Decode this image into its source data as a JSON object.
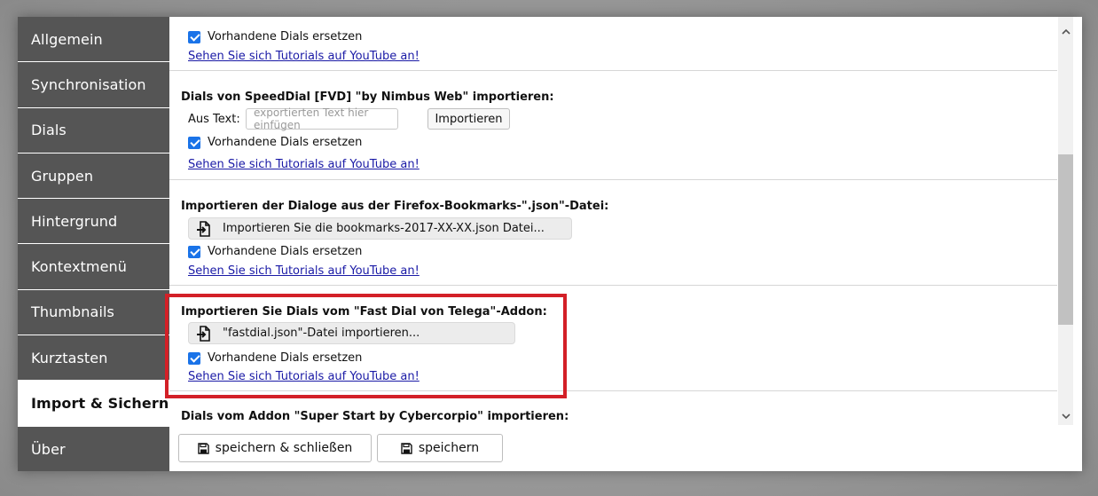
{
  "sidebar": {
    "items": [
      {
        "label": "Allgemein"
      },
      {
        "label": "Synchronisation"
      },
      {
        "label": "Dials"
      },
      {
        "label": "Gruppen"
      },
      {
        "label": "Hintergrund"
      },
      {
        "label": "Kontextmenü"
      },
      {
        "label": "Thumbnails"
      },
      {
        "label": "Kurztasten"
      },
      {
        "label": "Import & Sichern",
        "active": true
      },
      {
        "label": "Über"
      }
    ]
  },
  "sections": {
    "top": {
      "checkbox_label": "Vorhandene Dials ersetzen",
      "checked": true,
      "tutorial_link": "Sehen Sie sich Tutorials auf YouTube an!"
    },
    "speeddial": {
      "title": "Dials von SpeedDial [FVD] \"by Nimbus Web\" importieren:",
      "text_label": "Aus Text:",
      "text_placeholder": "exportierten Text hier einfügen",
      "import_button": "Importieren",
      "checkbox_label": "Vorhandene Dials ersetzen",
      "checked": true,
      "tutorial_link": "Sehen Sie sich Tutorials auf YouTube an!"
    },
    "firefox_bookmarks": {
      "title": "Importieren der Dialoge aus der Firefox-Bookmarks-\".json\"-Datei:",
      "file_button": "Importieren Sie die bookmarks-2017-XX-XX.json Datei...",
      "checkbox_label": "Vorhandene Dials ersetzen",
      "checked": true,
      "tutorial_link": "Sehen Sie sich Tutorials auf YouTube an!"
    },
    "fast_dial": {
      "title": "Importieren Sie Dials vom \"Fast Dial von Telega\"-Addon:",
      "file_button": "\"fastdial.json\"-Datei importieren...",
      "checkbox_label": "Vorhandene Dials ersetzen",
      "checked": true,
      "tutorial_link": "Sehen Sie sich Tutorials auf YouTube an!"
    },
    "super_start": {
      "title": "Dials vom Addon \"Super Start by Cybercorpio\" importieren:"
    }
  },
  "footer": {
    "save_close_label": "speichern & schließen",
    "save_label": "speichern"
  },
  "colors": {
    "sidebar_bg": "#555555",
    "checkbox": "#1a73e8",
    "link": "#1a1aa6",
    "highlight": "#d32027"
  },
  "icons": {
    "file_import": "file-import-icon",
    "save": "floppy-disk-icon",
    "scroll_up": "chevron-up-icon",
    "scroll_down": "chevron-down-icon"
  }
}
